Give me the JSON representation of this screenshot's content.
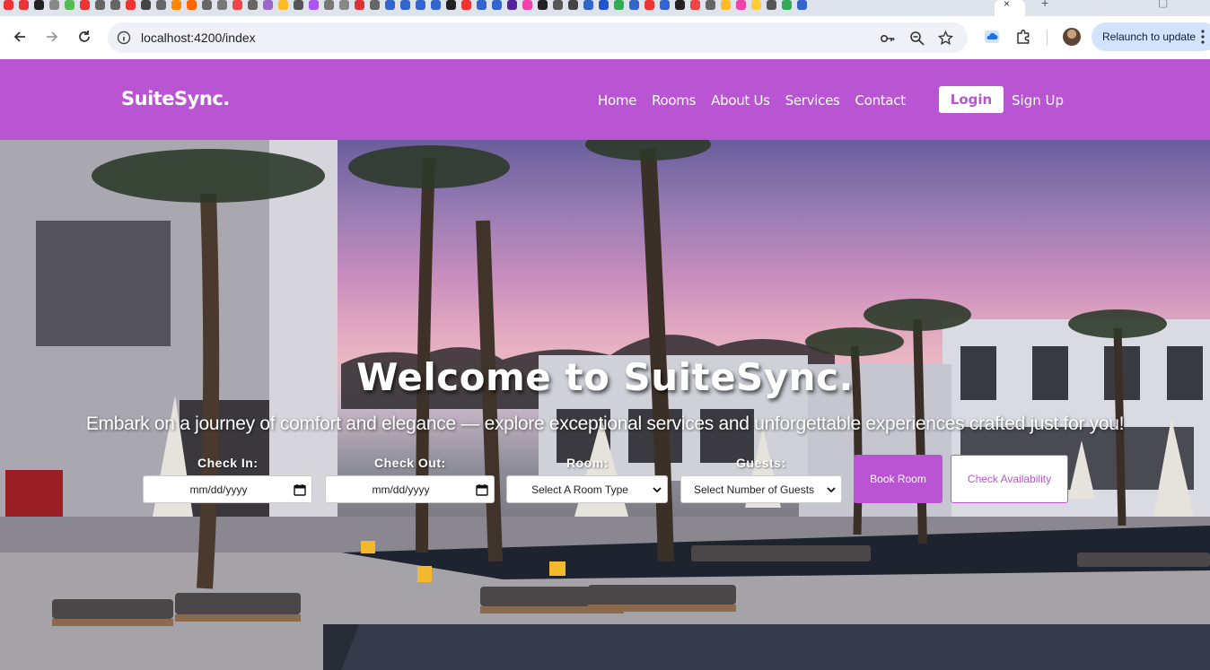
{
  "browser": {
    "url": "localhost:4200/index",
    "relaunch_label": "Relaunch to update",
    "tab_close": "×",
    "new_tab": "+"
  },
  "site": {
    "brand": "SuiteSync.",
    "nav": [
      "Home",
      "Rooms",
      "About Us",
      "Services",
      "Contact"
    ],
    "login": "Login",
    "signup": "Sign Up",
    "accent_color": "#b954d3"
  },
  "hero": {
    "title": "Welcome to SuiteSync.",
    "subtitle": "Embark on a journey of comfort and elegance — explore exceptional services and unforgettable experiences crafted just for you!"
  },
  "booking": {
    "checkin_label": "Check In:",
    "checkin_value": "mm/dd/yyyy",
    "checkout_label": "Check Out:",
    "checkout_value": "mm/dd/yyyy",
    "room_label": "Room:",
    "room_value": "Select A Room Type",
    "guests_label": "Guests:",
    "guests_value": "Select Number of Guests",
    "book_button": "Book Room",
    "availability_button": "Check Availability"
  }
}
